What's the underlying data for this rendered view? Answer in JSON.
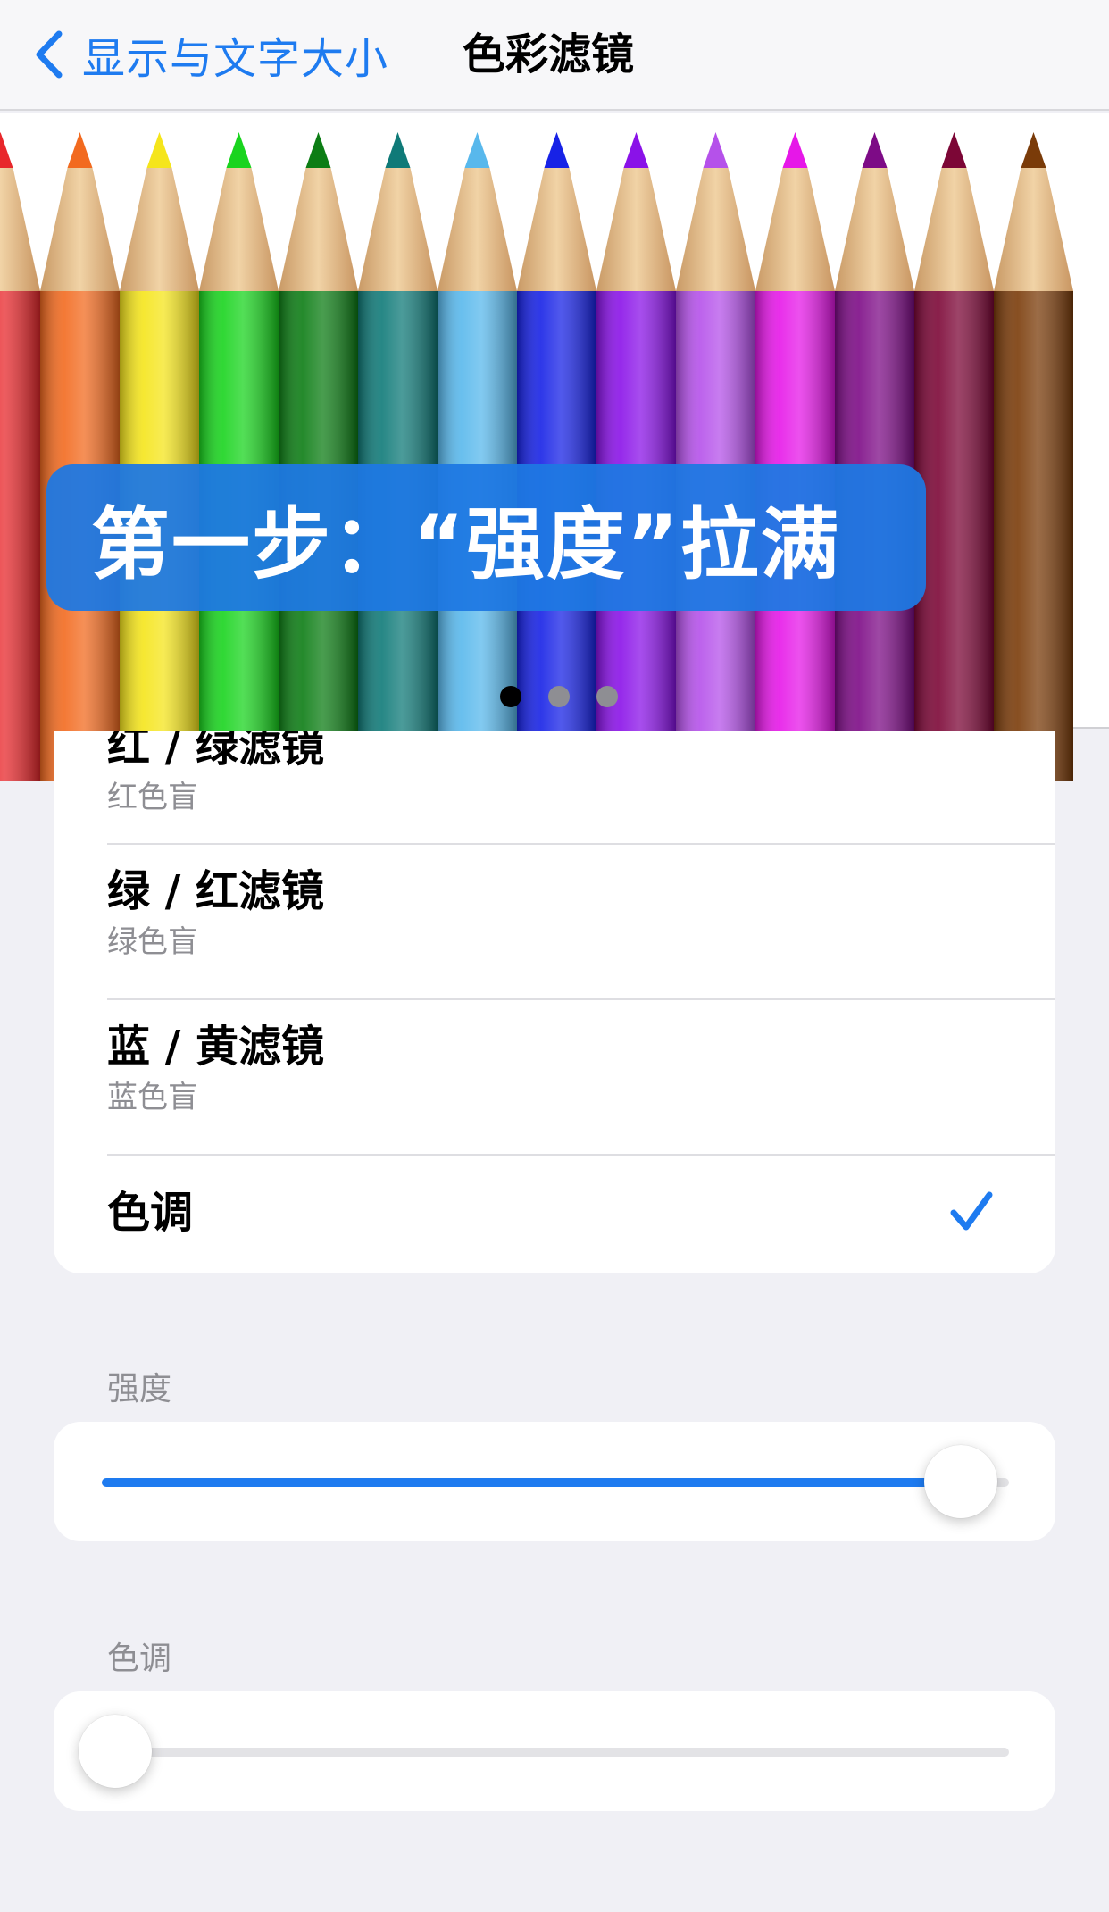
{
  "nav": {
    "back_label": "显示与文字大小",
    "title": "色彩滤镜"
  },
  "banner": {
    "caption": "第一步：“强度”拉满",
    "pencil_colors": [
      "#e8272b",
      "#f26a1f",
      "#f5e51b",
      "#19d41e",
      "#0c7d14",
      "#0f7a78",
      "#58b8ec",
      "#1722e6",
      "#8a12e8",
      "#b551ea",
      "#e617e8",
      "#7d0b86",
      "#7c0636",
      "#7a3b09"
    ],
    "pager": {
      "pages": 3,
      "current": 0
    }
  },
  "filters": {
    "items": [
      {
        "title": "红 / 绿滤镜",
        "subtitle": "红色盲",
        "selected": false
      },
      {
        "title": "绿 / 红滤镜",
        "subtitle": "绿色盲",
        "selected": false
      },
      {
        "title": "蓝 / 黄滤镜",
        "subtitle": "蓝色盲",
        "selected": false
      },
      {
        "title": "色调",
        "subtitle": "",
        "selected": true
      }
    ]
  },
  "intensity": {
    "label": "强度",
    "value_fraction": 0.96
  },
  "hue": {
    "label": "色调",
    "value_fraction": 0.0
  },
  "colors": {
    "accent": "#1e7bf0",
    "background": "#f0f0f5"
  }
}
